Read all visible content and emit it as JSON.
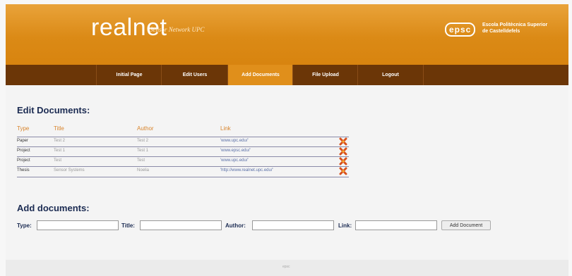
{
  "header": {
    "logo": "realnet",
    "tagline": "Sensor Network UPC",
    "badge": "epsc",
    "school_line1": "Escola Politècnica Superior",
    "school_line2": "de Castelldefels"
  },
  "nav": [
    {
      "label": "Initial Page",
      "active": false
    },
    {
      "label": "Edit Users",
      "active": false
    },
    {
      "label": "Add Documents",
      "active": true
    },
    {
      "label": "File Upload",
      "active": false
    },
    {
      "label": "Logout",
      "active": false
    }
  ],
  "edit": {
    "heading": "Edit Documents:",
    "columns": [
      "Type",
      "Title",
      "Author",
      "Link"
    ],
    "rows": [
      {
        "type": "Paper",
        "title": "Test 2",
        "author": "Test 2",
        "link": "'www.upc.edu/'"
      },
      {
        "type": "Project",
        "title": "Test 1",
        "author": "Test 1",
        "link": "'www.epsc.edu/'"
      },
      {
        "type": "Project",
        "title": "Test",
        "author": "Test",
        "link": "'www.upc.edu/'"
      },
      {
        "type": "Thesis",
        "title": "Sensor Systems",
        "author": "Noelia",
        "link": "'http://www.realnet.upc.edu/'"
      }
    ]
  },
  "add": {
    "heading": "Add documents:",
    "type_label": "Type:",
    "title_label": "Title:",
    "author_label": "Author:",
    "link_label": "Link:",
    "button": "Add Document"
  },
  "footer": {
    "text": "epsc"
  },
  "colors": {
    "header": "#db8a16",
    "nav": "#6b3607",
    "active_tab": "#e08f1b",
    "heading": "#1b2b52"
  }
}
